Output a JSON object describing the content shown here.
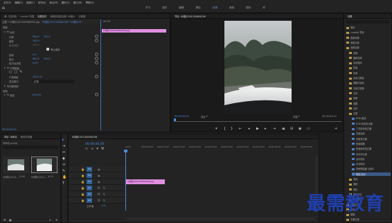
{
  "menu": [
    "文件(F)",
    "编辑(E)",
    "剪辑(C)",
    "序列(S)",
    "标记(M)",
    "图形(G)",
    "窗口(W)",
    "帮助(H)"
  ],
  "workspaces": [
    "学习",
    "组件",
    "编辑",
    "颜色",
    "效果",
    "音频",
    "图形",
    "库"
  ],
  "effect_controls": {
    "tabs": [
      "源: (无剪辑)",
      "Lumetri 范围",
      "效果控件",
      "音频剪辑混合器: 00图片",
      "元数据"
    ],
    "source": "主要 * 00照片201105084256.jpg",
    "sequence": "00图片201105084256 * 00图片20...",
    "time_start": "00:00",
    "section_video": "视频",
    "motion": "运动",
    "position": {
      "label": "位置",
      "x": "960.0",
      "y": "540.0"
    },
    "scale": {
      "label": "缩放",
      "value": "100.0"
    },
    "scale_width": {
      "label": "缩放宽度",
      "value": "100.0"
    },
    "uniform": "等比缩放",
    "rotation": {
      "label": "旋转",
      "value": "0.0"
    },
    "anchor": {
      "label": "锚点",
      "x": "960.0",
      "y": "540.0"
    },
    "anti_flicker": {
      "label": "防闪烁滤镜",
      "value": "0.00"
    },
    "opacity_section": "不透明度",
    "opacity": {
      "label": "不透明度",
      "value": "100.0 %"
    },
    "blend": {
      "label": "混合模式",
      "value": "正常"
    },
    "time_remap": "时间重映射",
    "volume_section": "音频",
    "volume": {
      "label": "音量",
      "value": "100.0%"
    },
    "clip_label": "00照片201105084256.jpg",
    "timecode": "00:00:00:00"
  },
  "program": {
    "title": "节目: 00图片201105084256",
    "timecode": "00:00:00:00",
    "fit": "适合",
    "quality": "完整",
    "duration": "00:00:04:10"
  },
  "project": {
    "tabs": [
      "项目: 未命名",
      "媒体浏览器"
    ],
    "name": "未命名.prproj",
    "items": [
      {
        "name": "00照片2011...",
        "dur": "5:00"
      },
      {
        "name": "00图片2011...",
        "dur": "4:10"
      }
    ]
  },
  "timeline": {
    "title": "00图片201105084256",
    "timecode": "00:00:00:00",
    "ruler": [
      "00:00",
      "00:00:05:00",
      "00:00:10:00",
      "00:00:15:00",
      "00:00:20:00",
      "00:00:25:00",
      "00:00:30:00",
      "00:00:35:00",
      "00:00:40:00",
      "00:00:45:00",
      "00:00:50:00",
      "00:00:55:00"
    ],
    "tracks_video": [
      "V3",
      "V2",
      "V1"
    ],
    "tracks_audio": [
      "A1",
      "A2",
      "A3"
    ],
    "clip_label": "00图片201105084256.jpg",
    "master": "主声道",
    "master_value": "0.0"
  },
  "effects_panel": {
    "title": "效果",
    "items": [
      {
        "t": "预设",
        "k": "folder",
        "d": 0
      },
      {
        "t": "Lumetri 预设",
        "k": "folder",
        "d": 0
      },
      {
        "t": "音频效果",
        "k": "folder",
        "d": 0
      },
      {
        "t": "音频过渡",
        "k": "folder",
        "d": 0
      },
      {
        "t": "视频效果",
        "k": "folder",
        "d": 0
      },
      {
        "t": "变换",
        "k": "folder",
        "d": 1
      },
      {
        "t": "图像控制",
        "k": "folder",
        "d": 1
      },
      {
        "t": "实用程序",
        "k": "folder",
        "d": 1
      },
      {
        "t": "扭曲",
        "k": "folder",
        "d": 1
      },
      {
        "t": "时间",
        "k": "folder",
        "d": 1
      },
      {
        "t": "杂色与颗粒",
        "k": "folder",
        "d": 1
      },
      {
        "t": "模糊与锐化",
        "k": "folder",
        "d": 1
      },
      {
        "t": "沉浸式视频",
        "k": "folder",
        "d": 1
      },
      {
        "t": "生成",
        "k": "folder",
        "d": 1
      },
      {
        "t": "视频",
        "k": "folder",
        "d": 1
      },
      {
        "t": "调整",
        "k": "folder",
        "d": 1
      },
      {
        "t": "过时",
        "k": "folder",
        "d": 1
      },
      {
        "t": "过渡",
        "k": "folder",
        "d": 1
      },
      {
        "t": "RGB 曲线",
        "k": "fx",
        "d": 2
      },
      {
        "t": "RGB 颜色校正器",
        "k": "fx",
        "d": 2
      },
      {
        "t": "三向颜色校正器",
        "k": "fx",
        "d": 2
      },
      {
        "t": "亮度曲线",
        "k": "fx",
        "d": 2
      },
      {
        "t": "亮度校正器",
        "k": "fx",
        "d": 2
      },
      {
        "t": "快速模糊",
        "k": "fx",
        "d": 2
      },
      {
        "t": "快速颜色校正器",
        "k": "fx",
        "d": 2
      },
      {
        "t": "自动对比度",
        "k": "fx",
        "d": 2
      },
      {
        "t": "自动色阶",
        "k": "fx",
        "d": 2
      },
      {
        "t": "自动颜色",
        "k": "fx",
        "d": 2
      },
      {
        "t": "视频限幅器 (旧版)",
        "k": "fx",
        "d": 2
      },
      {
        "t": "阴影/高光",
        "k": "fx",
        "d": 2,
        "sel": true
      },
      {
        "t": "透视",
        "k": "folder",
        "d": 1
      },
      {
        "t": "通道",
        "k": "folder",
        "d": 1
      },
      {
        "t": "键控",
        "k": "folder",
        "d": 1
      },
      {
        "t": "颜色校正",
        "k": "folder",
        "d": 1
      },
      {
        "t": "风格化",
        "k": "folder",
        "d": 1
      },
      {
        "t": "视频过渡",
        "k": "folder",
        "d": 0
      },
      {
        "t": "基本",
        "k": "folder",
        "d": 0
      },
      {
        "t": "模糊",
        "k": "folder",
        "d": 0
      },
      {
        "t": "字幕过渡",
        "k": "folder",
        "d": 0
      }
    ]
  },
  "watermark": "最需教育",
  "colors": {
    "accent": "#5b8fd9",
    "clip": "#e08ee0",
    "bg": "#1d1d1d",
    "track": "#2e5f96"
  }
}
